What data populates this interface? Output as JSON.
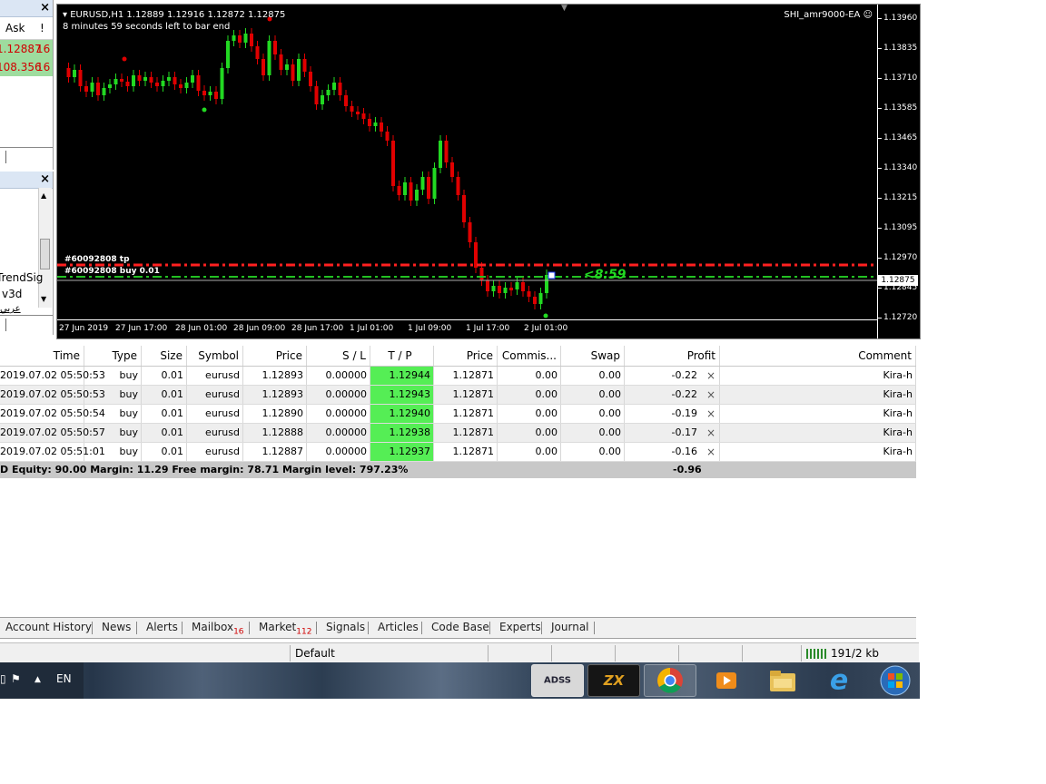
{
  "market_watch": {
    "close": "×",
    "col_ask": "Ask",
    "col_flag": "!",
    "rows": [
      {
        "ask": "1.12887",
        "spread": "16"
      },
      {
        "ask": "108.356",
        "spread": "16"
      }
    ]
  },
  "navigator": {
    "close": "×",
    "items": [
      "TrendSig",
      "v3d",
      "عربي"
    ]
  },
  "chart": {
    "symbol_line": "EURUSD,H1  1.12889 1.12916 1.12872 1.12875",
    "timer_line": "8 minutes 59 seconds left to bar end",
    "ea_label": "SHI_amr9000-EA",
    "current_price": "1.12875",
    "price_labels": [
      "1.13960",
      "1.13835",
      "1.13710",
      "1.13585",
      "1.13465",
      "1.13340",
      "1.13215",
      "1.13095",
      "1.12970",
      "1.12845",
      "1.12720"
    ],
    "time_labels": [
      "27 Jun 2019",
      "27 Jun 17:00",
      "28 Jun 01:00",
      "28 Jun 09:00",
      "28 Jun 17:00",
      "1 Jul 01:00",
      "1 Jul 09:00",
      "1 Jul 17:00",
      "2 Jul 01:00"
    ],
    "tp_label": "#60092808 tp",
    "order_label": "#60092808 buy 0.01",
    "countdown": "<8:59",
    "colors": {
      "bull": "#22d922",
      "bear": "#e00000",
      "tp_line": "#ff2020",
      "order_line": "#22c022"
    }
  },
  "trade_table": {
    "headers": [
      "Time",
      "Type",
      "Size",
      "Symbol",
      "Price",
      "S / L",
      "T / P",
      "Price",
      "Commis...",
      "Swap",
      "Profit",
      "Comment"
    ],
    "rows": [
      {
        "time": "2019.07.02 05:50:53",
        "type": "buy",
        "size": "0.01",
        "symbol": "eurusd",
        "price": "1.12893",
        "sl": "0.00000",
        "tp": "1.12944",
        "cur": "1.12871",
        "comm": "0.00",
        "swap": "0.00",
        "profit": "-0.22",
        "comment": "Kira-h"
      },
      {
        "time": "2019.07.02 05:50:53",
        "type": "buy",
        "size": "0.01",
        "symbol": "eurusd",
        "price": "1.12893",
        "sl": "0.00000",
        "tp": "1.12943",
        "cur": "1.12871",
        "comm": "0.00",
        "swap": "0.00",
        "profit": "-0.22",
        "comment": "Kira-h"
      },
      {
        "time": "2019.07.02 05:50:54",
        "type": "buy",
        "size": "0.01",
        "symbol": "eurusd",
        "price": "1.12890",
        "sl": "0.00000",
        "tp": "1.12940",
        "cur": "1.12871",
        "comm": "0.00",
        "swap": "0.00",
        "profit": "-0.19",
        "comment": "Kira-h"
      },
      {
        "time": "2019.07.02 05:50:57",
        "type": "buy",
        "size": "0.01",
        "symbol": "eurusd",
        "price": "1.12888",
        "sl": "0.00000",
        "tp": "1.12938",
        "cur": "1.12871",
        "comm": "0.00",
        "swap": "0.00",
        "profit": "-0.17",
        "comment": "Kira-h"
      },
      {
        "time": "2019.07.02 05:51:01",
        "type": "buy",
        "size": "0.01",
        "symbol": "eurusd",
        "price": "1.12887",
        "sl": "0.00000",
        "tp": "1.12937",
        "cur": "1.12871",
        "comm": "0.00",
        "swap": "0.00",
        "profit": "-0.16",
        "comment": "Kira-h"
      }
    ],
    "summary": {
      "text": "D  Equity: 90.00   Margin: 11.29   Free margin: 78.71   Margin level: 797.23%",
      "profit": "-0.96"
    }
  },
  "tabs": [
    {
      "label": "Account History"
    },
    {
      "label": "News"
    },
    {
      "label": "Alerts"
    },
    {
      "label": "Mailbox",
      "badge": "16"
    },
    {
      "label": "Market",
      "badge": "112"
    },
    {
      "label": "Signals"
    },
    {
      "label": "Articles"
    },
    {
      "label": "Code Base"
    },
    {
      "label": "Experts"
    },
    {
      "label": "Journal"
    }
  ],
  "status_bar": {
    "profile": "Default",
    "traffic": "191/2 kb"
  },
  "taskbar": {
    "language": "EN",
    "apps": [
      {
        "name": "adss-icon",
        "label": "ADSS"
      },
      {
        "name": "zx-icon",
        "label": "ZX"
      },
      {
        "name": "chrome-icon",
        "label": ""
      },
      {
        "name": "media-player-icon",
        "label": ""
      },
      {
        "name": "folder-icon",
        "label": ""
      },
      {
        "name": "internet-explorer-icon",
        "label": ""
      },
      {
        "name": "windows-start-icon",
        "label": ""
      }
    ]
  }
}
